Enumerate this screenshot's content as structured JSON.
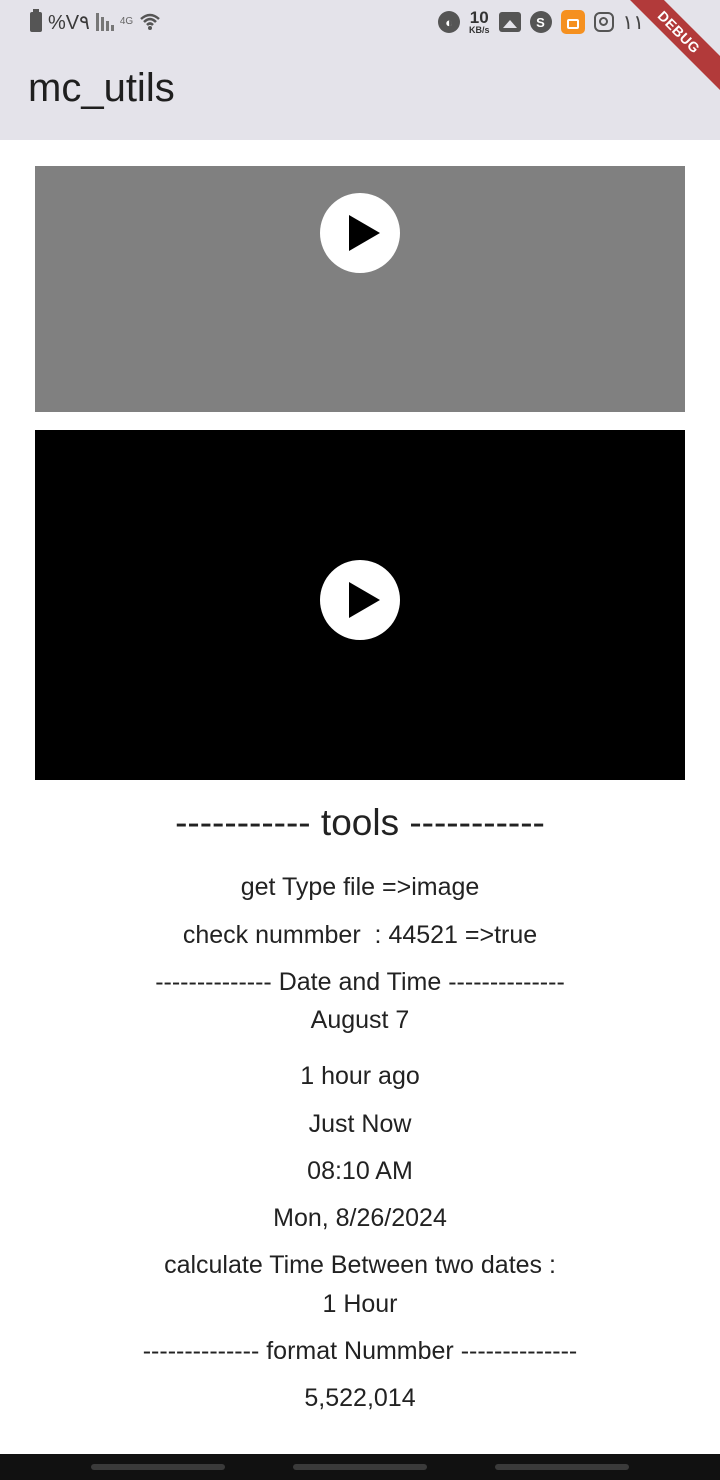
{
  "status_bar": {
    "battery_text": "%V٩",
    "network_text": "4G",
    "net_speed_value": "10",
    "net_speed_unit": "KB/s",
    "time": "۱۱"
  },
  "debug_banner": "DEBUG",
  "app_bar": {
    "title": "mc_utils"
  },
  "videos": [
    {
      "background": "#808080"
    },
    {
      "background": "#000000"
    }
  ],
  "tools": {
    "header": "----------- tools -----------",
    "file_type": "get Type file =>image",
    "check_number": "check nummber  : 44521 =>true",
    "date_time_header": "-------------- Date and Time --------------",
    "date": "August 7",
    "time_ago": "1 hour ago",
    "just_now": "Just Now",
    "clock_time": "08:10 AM",
    "full_date": "Mon, 8/26/2024",
    "between_label": "calculate Time Between two dates :",
    "between_value": "1 Hour",
    "format_number_header": "-------------- format Nummber --------------",
    "formatted_number": "5,522,014"
  },
  "colors": {
    "app_bar_bg": "#e4e3ea",
    "debug_ribbon": "#b23a3a"
  }
}
